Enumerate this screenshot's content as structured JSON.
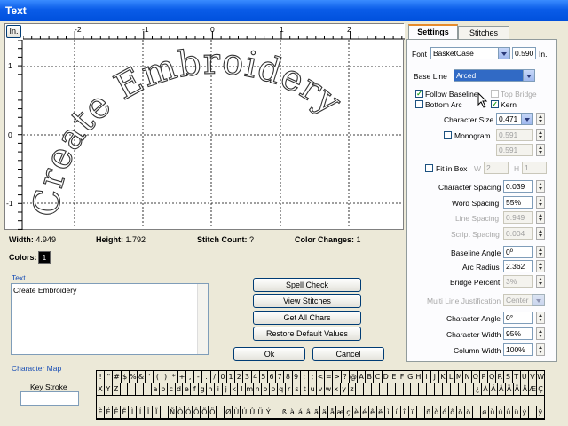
{
  "window": {
    "title": "Text"
  },
  "canvas": {
    "unit_button": "In.",
    "ruler_top": [
      "-2",
      "-1",
      "0",
      "1",
      "2"
    ],
    "ruler_left": [
      "1",
      "0",
      "-1"
    ],
    "design_text": "Create Embroidery"
  },
  "stats": {
    "width_label": "Width:",
    "width_value": "4.949",
    "height_label": "Height:",
    "height_value": "1.792",
    "stitch_label": "Stitch Count:",
    "stitch_value": "?",
    "color_label": "Color Changes:",
    "color_value": "1",
    "colors_label": "Colors:",
    "colors_chip": "1"
  },
  "text_area": {
    "label": "Text",
    "value": "Create Embroidery"
  },
  "actions": {
    "spell_check": "Spell Check",
    "view_stitches": "View Stitches",
    "get_all_chars": "Get All Chars",
    "restore_defaults": "Restore Default Values",
    "ok": "Ok",
    "cancel": "Cancel"
  },
  "tabs": {
    "settings": "Settings",
    "stitches": "Stitches"
  },
  "settings": {
    "font_label": "Font",
    "font_value": "BasketCase",
    "font_size": "0.590",
    "font_unit": "In.",
    "baseline_label": "Base Line",
    "baseline_value": "Arced",
    "follow_baseline": "Follow Baseline",
    "top_bridge": "Top Bridge",
    "bottom_arc": "Bottom Arc",
    "kern": "Kern",
    "char_size_label": "Character Size",
    "char_size_value": "0.471",
    "monogram_label": "Monogram",
    "mono_v1": "0.591",
    "mono_v2": "0.591",
    "fit_in_box": "Fit in Box",
    "w_label": "W",
    "w_value": "2",
    "h_label": "H",
    "h_value": "1",
    "char_spacing_label": "Character Spacing",
    "char_spacing_value": "0.039",
    "word_spacing_label": "Word Spacing",
    "word_spacing_value": "55%",
    "line_spacing_label": "Line Spacing",
    "line_spacing_value": "0.949",
    "script_spacing_label": "Script Spacing",
    "script_spacing_value": "0.004",
    "baseline_angle_label": "Baseline Angle",
    "baseline_angle_value": "0º",
    "arc_radius_label": "Arc Radius",
    "arc_radius_value": "2.362",
    "bridge_percent_label": "Bridge Percent",
    "bridge_percent_value": "3%",
    "multiline_label": "Multi Line Justification",
    "multiline_value": "Center",
    "char_angle_label": "Character Angle",
    "char_angle_value": "0°",
    "char_width_label": "Character Width",
    "char_width_value": "95%",
    "col_width_label": "Column Width",
    "col_width_value": "100%"
  },
  "charmap": {
    "label": "Character Map",
    "keystroke_label": "Key Stroke",
    "row1": [
      "!",
      "\"",
      "#",
      "$",
      "%",
      "&",
      "'",
      "(",
      ")",
      "*",
      "+",
      ",",
      "-",
      ".",
      "/",
      "0",
      "1",
      "2",
      "3",
      "4",
      "5",
      "6",
      "7",
      "8",
      "9",
      ":",
      ";",
      "<",
      "=",
      ">",
      "?",
      "@",
      "A",
      "B",
      "C",
      "D",
      "E",
      "F",
      "G",
      "H",
      "I",
      "J",
      "K",
      "L",
      "M",
      "N",
      "O",
      "P",
      "Q",
      "R",
      "S",
      "T",
      "U",
      "V",
      "W"
    ],
    "row2": [
      "X",
      "Y",
      "Z",
      "",
      "",
      "",
      "",
      "a",
      "b",
      "c",
      "d",
      "e",
      "f",
      "g",
      "h",
      "i",
      "j",
      "k",
      "l",
      "m",
      "n",
      "o",
      "p",
      "q",
      "r",
      "s",
      "t",
      "u",
      "v",
      "w",
      "x",
      "y",
      "z",
      "",
      "",
      "",
      "",
      "",
      "",
      "",
      "",
      "",
      "",
      "",
      "",
      "",
      "",
      "",
      "¿",
      "À",
      "Á",
      "Â",
      "Ã",
      "Ä",
      "Å",
      "Æ",
      "Ç"
    ],
    "row3": [
      "È",
      "É",
      "Ê",
      "Ë",
      "Ì",
      "Í",
      "Î",
      "Ï",
      "",
      "Ñ",
      "Ò",
      "Ó",
      "Ô",
      "Õ",
      "Ö",
      "",
      "Ø",
      "Ù",
      "Ú",
      "Û",
      "Ü",
      "Ý",
      "",
      "ß",
      "à",
      "á",
      "â",
      "ã",
      "ä",
      "å",
      "æ",
      "ç",
      "è",
      "é",
      "ê",
      "ë",
      "ì",
      "í",
      "î",
      "ï",
      "",
      "ñ",
      "ò",
      "ó",
      "ô",
      "õ",
      "ö",
      "",
      "ø",
      "ù",
      "ú",
      "û",
      "ü",
      "ý",
      "",
      "ÿ"
    ]
  },
  "colors": {
    "chip": "#000000",
    "accent": "#0a5ce8"
  }
}
